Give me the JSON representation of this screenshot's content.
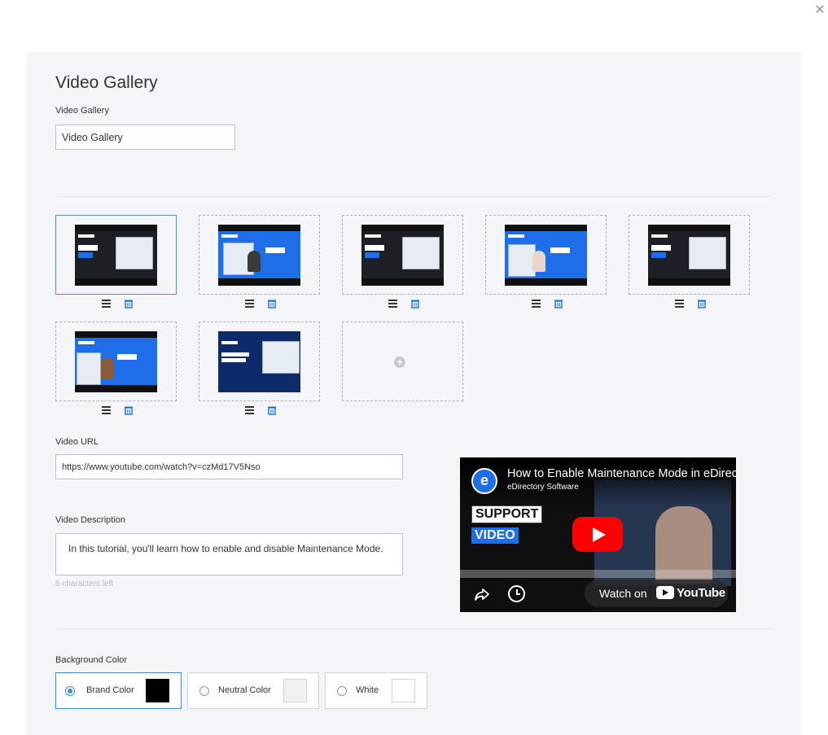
{
  "modal": {
    "close_symbol": "✕"
  },
  "page": {
    "title": "Video Gallery"
  },
  "gallery_name": {
    "label": "Video Gallery",
    "value": "Video Gallery"
  },
  "thumbnails": [
    {
      "style": "dark",
      "badge": "SUPPORT VIDEO",
      "selected": true
    },
    {
      "style": "blue",
      "badge": "LIVE WEBINAR",
      "selected": false
    },
    {
      "style": "dark",
      "badge": "SUPPORT VIDEO",
      "selected": false
    },
    {
      "style": "blue",
      "badge": "LIVE WEBINAR",
      "selected": false
    },
    {
      "style": "dark",
      "badge": "SUPPORT VIDEO",
      "selected": false
    },
    {
      "style": "blue",
      "badge": "LIVE WEBINAR",
      "selected": false
    },
    {
      "style": "blue",
      "badge": "How to Login as a Site Manager",
      "selected": false
    }
  ],
  "video_url": {
    "label": "Video URL",
    "value": "https://www.youtube.com/watch?v=czMd17V5Nso"
  },
  "video_description": {
    "label": "Video Description",
    "value": "In this tutorial, you'll learn how to enable and disable Maintenance Mode.",
    "hint": "6 characters left"
  },
  "player": {
    "video_title": "How to Enable Maintenance Mode in eDirectory",
    "channel": "eDirectory Software",
    "channel_initial": "e",
    "badge_top": "SUPPORT",
    "badge_bottom": "VIDEO",
    "watch_on": "Watch on",
    "youtube": "YouTube"
  },
  "background_color": {
    "label": "Background Color",
    "options": [
      {
        "label": "Brand Color",
        "color": "#000000",
        "selected": true
      },
      {
        "label": "Neutral Color",
        "color": "#f0f1f3",
        "selected": false
      },
      {
        "label": "White",
        "color": "#ffffff",
        "selected": false
      }
    ]
  },
  "colors": {
    "accent": "#3f8ad2",
    "panel": "#f4f5f8"
  }
}
